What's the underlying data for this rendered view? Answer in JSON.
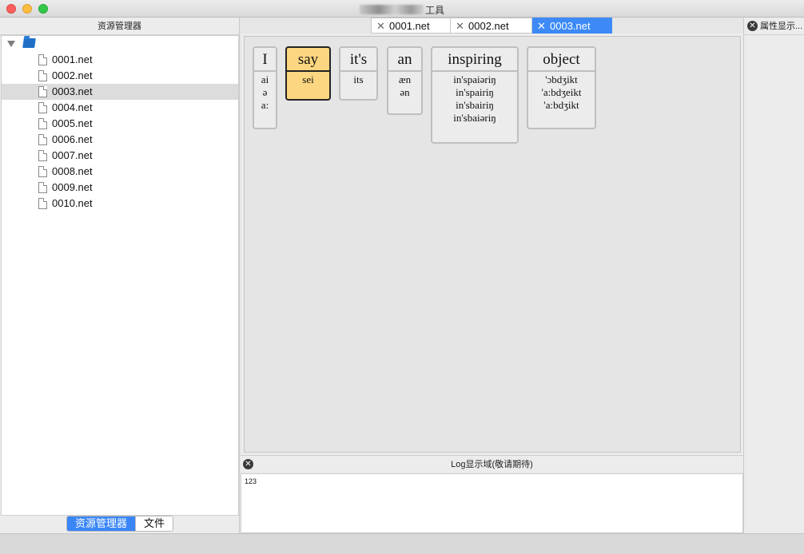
{
  "window": {
    "title": "工具"
  },
  "explorer": {
    "header": "资源管理器",
    "root_icon": "folder-icon",
    "items": [
      {
        "label": "0001.net",
        "selected": false
      },
      {
        "label": "0002.net",
        "selected": false
      },
      {
        "label": "0003.net",
        "selected": true
      },
      {
        "label": "0004.net",
        "selected": false
      },
      {
        "label": "0005.net",
        "selected": false
      },
      {
        "label": "0006.net",
        "selected": false
      },
      {
        "label": "0007.net",
        "selected": false
      },
      {
        "label": "0008.net",
        "selected": false
      },
      {
        "label": "0009.net",
        "selected": false
      },
      {
        "label": "0010.net",
        "selected": false
      }
    ],
    "bottom_tabs": [
      {
        "label": "资源管理器",
        "active": true
      },
      {
        "label": "文件",
        "active": false
      }
    ]
  },
  "editor": {
    "tabs": [
      {
        "label": "0001.net",
        "active": false
      },
      {
        "label": "0002.net",
        "active": false
      },
      {
        "label": "0003.net",
        "active": true
      }
    ],
    "cards": [
      {
        "word": "I",
        "phonetics": [
          "ai",
          "ə",
          "a:"
        ],
        "highlighted": false
      },
      {
        "word": "say",
        "phonetics": [
          "sei"
        ],
        "highlighted": true
      },
      {
        "word": "it's",
        "phonetics": [
          "its"
        ],
        "highlighted": false
      },
      {
        "word": "an",
        "phonetics": [
          "æn",
          "ən"
        ],
        "highlighted": false
      },
      {
        "word": "inspiring",
        "phonetics": [
          "in'spaiəriŋ",
          "in'spairiŋ",
          "in'sbairiŋ",
          "in'sbaiəriŋ"
        ],
        "highlighted": false
      },
      {
        "word": "object",
        "phonetics": [
          "'ɔbdʒikt",
          "'a:bdʒeikt",
          "'a:bdʒikt"
        ],
        "highlighted": false
      }
    ],
    "highlight_color": "#fcd680"
  },
  "log": {
    "header": "Log显示域(敬请期待)",
    "content": "123"
  },
  "properties": {
    "header": "属性显示..."
  },
  "colors": {
    "accent": "#3a86f7"
  }
}
